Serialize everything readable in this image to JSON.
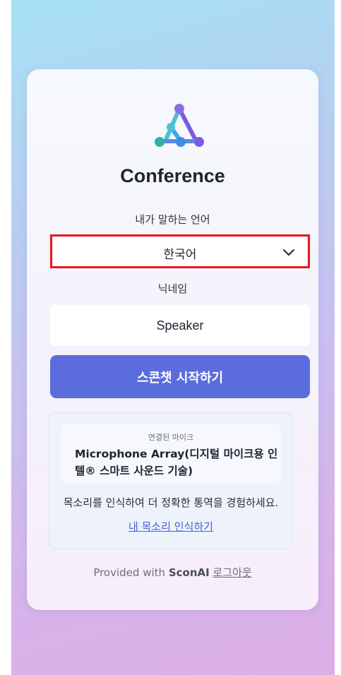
{
  "app": {
    "title": "Conference"
  },
  "language": {
    "label": "내가 말하는 언어",
    "selected": "한국어"
  },
  "nickname": {
    "label": "닉네임",
    "value": "Speaker"
  },
  "start_button": {
    "label": "스콘챗 시작하기"
  },
  "microphone": {
    "caption": "연결된 마이크",
    "name": "Microphone Array(디지털 마이크용 인텔® 스마트 사운드 기술)",
    "description": "목소리를 인식하여 더 정확한 통역을 경험하세요.",
    "link_label": "내 목소리 인식하기"
  },
  "footer": {
    "provided_with": "Provided with",
    "brand": "SconAI",
    "logout": "로그아웃"
  },
  "colors": {
    "accent": "#5b6ddc",
    "link": "#4a5fd6",
    "highlight_border": "#e8161b"
  },
  "icons": {
    "logo": "network-triangle-logo",
    "dropdown": "chevron-down-icon"
  }
}
